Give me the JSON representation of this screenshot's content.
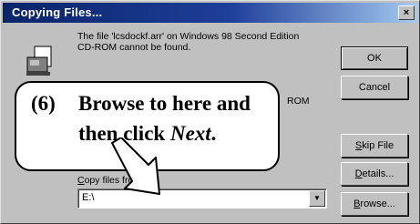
{
  "window": {
    "title": "Copying Files...",
    "close_glyph": "×"
  },
  "message": {
    "text": "The file 'lcsdockf.arr' on Windows 98 Second Edition CD-ROM cannot be found.",
    "trailing": "ROM"
  },
  "buttons": {
    "ok": "OK",
    "cancel": "Cancel",
    "skip_file": "Skip File",
    "details": "Details...",
    "browse": "Browse..."
  },
  "copy_files_from": {
    "label": "Copy files from:",
    "value": "E:\\",
    "arrow_glyph": "▼"
  },
  "callout": {
    "number": "(6)",
    "line1": "Browse to here and",
    "line2_prefix": "then click ",
    "line2_emphasis": "Next",
    "line2_suffix": "."
  },
  "icons": {
    "copy": "copy-files-icon",
    "pointer": "arrow-pointer-icon"
  }
}
